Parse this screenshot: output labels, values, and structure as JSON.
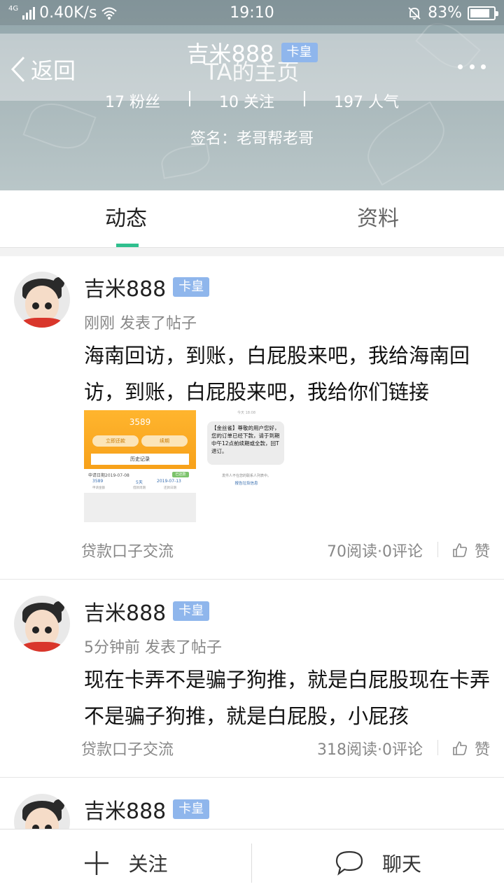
{
  "status_bar": {
    "network": "4G",
    "speed": "0.40K/s",
    "time": "19:10",
    "battery": "83%",
    "battery_level": 0.83,
    "icons": [
      "signal-icon",
      "wifi-icon",
      "bell-icon",
      "battery-icon"
    ]
  },
  "navbar": {
    "back_label": "返回",
    "title": "TA的主页",
    "more_icon": "more-dots-icon"
  },
  "profile": {
    "name": "吉米888",
    "badge": "卡皇",
    "fans": "17 粉丝",
    "following": "10 关注",
    "popularity": "197 人气",
    "signature": "签名：老哥帮老哥"
  },
  "tabs": [
    {
      "label": "动态",
      "active": true
    },
    {
      "label": "资料",
      "active": false
    }
  ],
  "posts": [
    {
      "author": "吉米888",
      "badge": "卡皇",
      "meta": "刚刚  发表了帖子",
      "body": "海南回访，到账，白屁股来吧，我给海南回访，到账，白屁股来吧，我给你们链接",
      "category": "贷款口子交流",
      "stats": "70阅读·0评论",
      "like_label": "赞",
      "images": [
        {
          "amount": "3589",
          "btn_left": "立即还款",
          "btn_right": "续期",
          "history": "历史记录",
          "apply_date": "申请日期2019-07-08",
          "status_tag": "已还款",
          "value_amount": "3589",
          "value_days": "5天",
          "value_due": "2019-07-13",
          "label_amount": "申请金额",
          "label_days": "借款周期",
          "label_due": "还款日期"
        },
        {
          "time": "今天 18:08",
          "sms": "【金丝雀】尊敬的用户您好，您的订单已经下款，请于到期中午12点前续期或全款，回T退订。",
          "note": "发件人不在您的联系人列表中。",
          "report": "报告垃圾信息"
        }
      ]
    },
    {
      "author": "吉米888",
      "badge": "卡皇",
      "meta": "5分钟前  发表了帖子",
      "body": "现在卡弄不是骗子狗推，就是白屁股现在卡弄不是骗子狗推，就是白屁股，小屁孩",
      "category": "贷款口子交流",
      "stats": "318阅读·0评论",
      "like_label": "赞"
    },
    {
      "author": "吉米888",
      "badge": "卡皇"
    }
  ],
  "bottom_bar": {
    "follow_label": "关注",
    "chat_label": "聊天"
  },
  "colors": {
    "accent": "#2fbf8e",
    "badge": "#8fb6ec",
    "meta_text": "#888888"
  }
}
